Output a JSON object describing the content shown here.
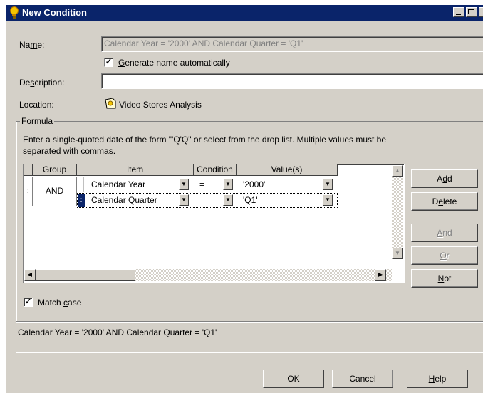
{
  "window": {
    "title": "New Condition"
  },
  "name_field": {
    "label_pre": "Na",
    "label_ul": "m",
    "label_post": "e:",
    "value": "Calendar Year = '2000' AND Calendar Quarter = 'Q1'"
  },
  "auto_name": {
    "checked_mark": "✓",
    "label_pre": "",
    "label_ul": "G",
    "label_post": "enerate name automatically"
  },
  "description": {
    "label_pre": "De",
    "label_ul": "s",
    "label_post": "cription:",
    "value": ""
  },
  "location": {
    "label": "Location:",
    "value": "Video Stores Analysis"
  },
  "formula": {
    "legend": "Formula",
    "hint_line1": "Enter a single-quoted date of the form \"'Q'Q\" or select from the drop list. Multiple values must be",
    "hint_line2": "separated with commas.",
    "columns": [
      "Group",
      "Item",
      "Condition",
      "Value(s)"
    ],
    "group_label": "AND",
    "rows": [
      {
        "item": "Calendar Year",
        "condition": "=",
        "value": "'2000'"
      },
      {
        "item": "Calendar Quarter",
        "condition": "=",
        "value": "'Q1'"
      }
    ]
  },
  "side_buttons": {
    "add": {
      "pre": "A",
      "ul": "d",
      "post": "d"
    },
    "delete": {
      "pre": "D",
      "ul": "e",
      "post": "lete"
    },
    "and": {
      "pre": "",
      "ul": "A",
      "post": "nd"
    },
    "or": {
      "pre": "",
      "ul": "O",
      "post": "r"
    },
    "not": {
      "pre": "",
      "ul": "N",
      "post": "ot"
    }
  },
  "match_case": {
    "checked_mark": "✓",
    "label_pre": "Match ",
    "label_ul": "c",
    "label_post": "ase"
  },
  "summary": "Calendar Year = '2000' AND Calendar Quarter = 'Q1'",
  "footer": {
    "ok": "OK",
    "cancel": "Cancel",
    "help": {
      "pre": "",
      "ul": "H",
      "post": "elp"
    }
  }
}
